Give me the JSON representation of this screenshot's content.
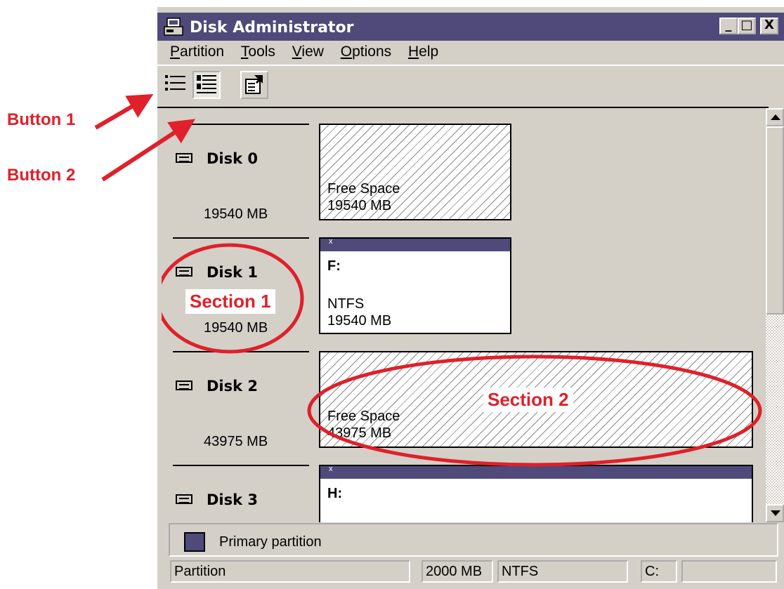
{
  "window": {
    "title": "Disk Administrator",
    "controls": {
      "minimize": "_",
      "maximize": "□",
      "close": "X"
    }
  },
  "menu": {
    "items": [
      {
        "label": "Partition",
        "accel": "P",
        "rest": "artition"
      },
      {
        "label": "Tools",
        "accel": "T",
        "rest": "ools"
      },
      {
        "label": "View",
        "accel": "V",
        "rest": "iew"
      },
      {
        "label": "Options",
        "accel": "O",
        "rest": "ptions"
      },
      {
        "label": "Help",
        "accel": "H",
        "rest": "elp"
      }
    ]
  },
  "toolbar": {
    "icons": [
      "volumes-view-icon",
      "disk-config-view-icon",
      "properties-icon"
    ]
  },
  "disks": [
    {
      "name": "Disk 0",
      "size": "19540 MB",
      "partition": {
        "type": "free",
        "line1": "Free Space",
        "line2": "19540 MB"
      }
    },
    {
      "name": "Disk 1",
      "size": "19540 MB",
      "partition": {
        "type": "primary",
        "drive": "F:",
        "fs": "NTFS",
        "line2": "19540 MB"
      }
    },
    {
      "name": "Disk 2",
      "size": "43975 MB",
      "partition": {
        "type": "free",
        "line1": "Free Space",
        "line2": "43975 MB"
      }
    },
    {
      "name": "Disk 3",
      "size": "",
      "partition": {
        "type": "primary",
        "drive": "H:"
      }
    }
  ],
  "partition_bar_mark": "x",
  "legend": {
    "primary_partition": "Primary partition",
    "primary_color": "#4f4a7a"
  },
  "status": {
    "type": "Partition",
    "size": "2000 MB",
    "fs": "NTFS",
    "drive": "C:",
    "extra": ""
  },
  "annotations": {
    "button1": "Button 1",
    "button2": "Button 2",
    "section1": "Section 1",
    "section2": "Section 2",
    "color": "#e0202a"
  }
}
